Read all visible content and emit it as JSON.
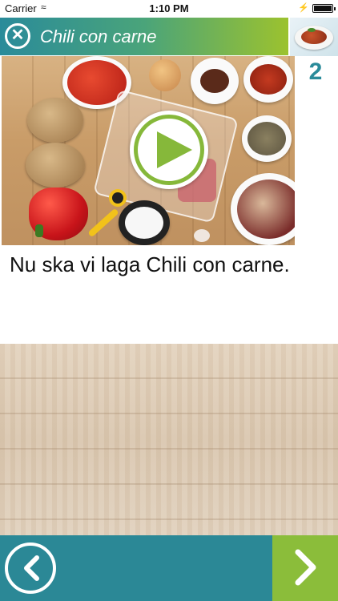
{
  "status_bar": {
    "carrier": "Carrier",
    "time": "1:10 PM"
  },
  "header": {
    "title": "Chili con carne",
    "close_icon": "close-icon"
  },
  "step": {
    "number": "2"
  },
  "media": {
    "play_icon": "play-icon"
  },
  "instruction": {
    "text": "Nu ska vi laga Chili con carne."
  },
  "navigation": {
    "prev_icon": "chevron-left-icon",
    "next_icon": "chevron-right-icon"
  },
  "colors": {
    "header_gradient_start": "#2a8b9a",
    "header_gradient_end": "#9cc22e",
    "accent_green": "#8bbd3a",
    "footer_teal": "#2b8896",
    "step_number": "#2a8b9a"
  }
}
